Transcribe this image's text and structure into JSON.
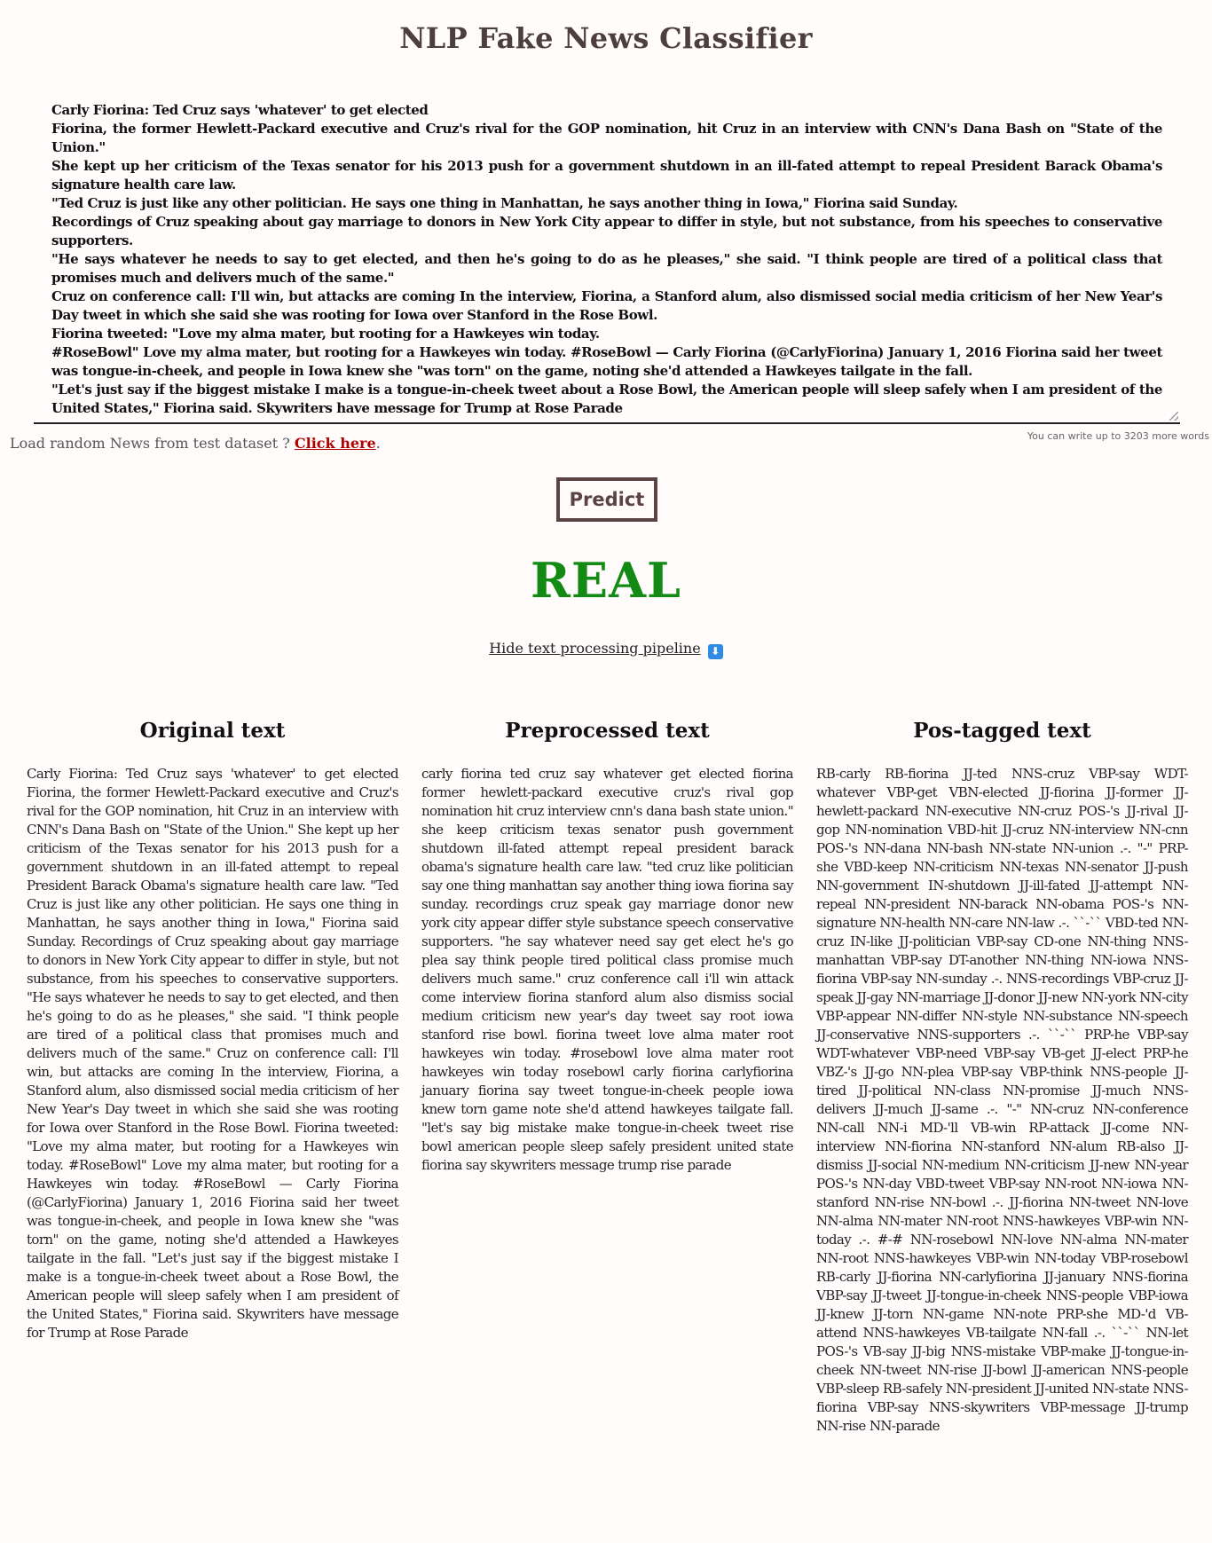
{
  "header": {
    "title": "NLP Fake News Classifier"
  },
  "input": {
    "text": "Carly Fiorina: Ted Cruz says 'whatever' to get elected\nFiorina, the former Hewlett-Packard executive and Cruz's rival for the GOP nomination, hit Cruz in an interview with CNN's Dana Bash on \"State of the Union.\"\nShe kept up her criticism of the Texas senator for his 2013 push for a government shutdown in an ill-fated attempt to repeal President Barack Obama's signature health care law.\n\"Ted Cruz is just like any other politician. He says one thing in Manhattan, he says another thing in Iowa,\" Fiorina said Sunday.\nRecordings of Cruz speaking about gay marriage to donors in New York City appear to differ in style, but not substance, from his speeches to conservative supporters.\n\"He says whatever he needs to say to get elected, and then he's going to do as he pleases,\" she said. \"I think people are tired of a political class that promises much and delivers much of the same.\"\nCruz on conference call: I'll win, but attacks are coming In the interview, Fiorina, a Stanford alum, also dismissed social media criticism of her New Year's Day tweet in which she said she was rooting for Iowa over Stanford in the Rose Bowl.\nFiorina tweeted: \"Love my alma mater, but rooting for a Hawkeyes win today.\n#RoseBowl\" Love my alma mater, but rooting for a Hawkeyes win today. #RoseBowl — Carly Fiorina (@CarlyFiorina) January 1, 2016 Fiorina said her tweet was tongue-in-cheek, and people in Iowa knew she \"was torn\" on the game, noting she'd attended a Hawkeyes tailgate in the fall.\n\"Let's just say if the biggest mistake I make is a tongue-in-cheek tweet about a Rose Bowl, the American people will sleep safely when I am president of the United States,\" Fiorina said. Skywriters have message for Trump at Rose Parade",
    "word_counter": "You can write up to 3203 more words"
  },
  "load_random": {
    "prefix": "Load random News from test dataset ? ",
    "link_label": "Click here",
    "suffix": "."
  },
  "predict_button": {
    "label": "Predict"
  },
  "result": {
    "label": "REAL",
    "color": "#138a13"
  },
  "pipeline_toggle": {
    "label": "Hide text processing pipeline",
    "icon": "down-arrow-icon",
    "icon_glyph": "⬇"
  },
  "columns": {
    "original": {
      "title": "Original text",
      "text": "Carly Fiorina: Ted Cruz says 'whatever' to get elected Fiorina, the former Hewlett-Packard executive and Cruz's rival for the GOP nomination, hit Cruz in an interview with CNN's Dana Bash on \"State of the Union.\" She kept up her criticism of the Texas senator for his 2013 push for a government shutdown in an ill-fated attempt to repeal President Barack Obama's signature health care law. \"Ted Cruz is just like any other politician. He says one thing in Manhattan, he says another thing in Iowa,\" Fiorina said Sunday. Recordings of Cruz speaking about gay marriage to donors in New York City appear to differ in style, but not substance, from his speeches to conservative supporters. \"He says whatever he needs to say to get elected, and then he's going to do as he pleases,\" she said. \"I think people are tired of a political class that promises much and delivers much of the same.\" Cruz on conference call: I'll win, but attacks are coming In the interview, Fiorina, a Stanford alum, also dismissed social media criticism of her New Year's Day tweet in which she said she was rooting for Iowa over Stanford in the Rose Bowl. Fiorina tweeted: \"Love my alma mater, but rooting for a Hawkeyes win today. #RoseBowl\" Love my alma mater, but rooting for a Hawkeyes win today. #RoseBowl — Carly Fiorina (@CarlyFiorina) January 1, 2016 Fiorina said her tweet was tongue-in-cheek, and people in Iowa knew she \"was torn\" on the game, noting she'd attended a Hawkeyes tailgate in the fall. \"Let's just say if the biggest mistake I make is a tongue-in-cheek tweet about a Rose Bowl, the American people will sleep safely when I am president of the United States,\" Fiorina said. Skywriters have message for Trump at Rose Parade"
    },
    "preprocessed": {
      "title": "Preprocessed text",
      "text": "carly fiorina ted cruz say whatever get elected fiorina former hewlett-packard executive cruz's rival gop nomination hit cruz interview cnn's dana bash state union.\" she keep criticism texas senator push government shutdown ill-fated attempt repeal president barack obama's signature health care law. \"ted cruz like politician say one thing manhattan say another thing iowa fiorina say sunday. recordings cruz speak gay marriage donor new york city appear differ style substance speech conservative supporters. \"he say whatever need say get elect he's go plea say think people tired political class promise much delivers much same.\" cruz conference call i'll win attack come interview fiorina stanford alum also dismiss social medium criticism new year's day tweet say root iowa stanford rise bowl. fiorina tweet love alma mater root hawkeyes win today. #rosebowl love alma mater root hawkeyes win today rosebowl carly fiorina carlyfiorina january fiorina say tweet tongue-in-cheek people iowa knew torn game note she'd attend hawkeyes tailgate fall. \"let's say big mistake make tongue-in-cheek tweet rise bowl american people sleep safely president united state fiorina say skywriters message trump rise parade"
    },
    "postagged": {
      "title": "Pos-tagged text",
      "text": "RB-carly RB-fiorina JJ-ted NNS-cruz VBP-say WDT-whatever VBP-get VBN-elected JJ-fiorina JJ-former JJ-hewlett-packard NN-executive NN-cruz POS-'s JJ-rival JJ-gop NN-nomination VBD-hit JJ-cruz NN-interview NN-cnn POS-'s NN-dana NN-bash NN-state NN-union .-. \"-\" PRP-she VBD-keep NN-criticism NN-texas NN-senator JJ-push NN-government IN-shutdown JJ-ill-fated JJ-attempt NN-repeal NN-president NN-barack NN-obama POS-'s NN-signature NN-health NN-care NN-law .-. ``-`` VBD-ted NN-cruz IN-like JJ-politician VBP-say CD-one NN-thing NNS-manhattan VBP-say DT-another NN-thing NN-iowa NNS-fiorina VBP-say NN-sunday .-. NNS-recordings VBP-cruz JJ-speak JJ-gay NN-marriage JJ-donor JJ-new NN-york NN-city VBP-appear NN-differ NN-style NN-substance NN-speech JJ-conservative NNS-supporters .-. ``-`` PRP-he VBP-say WDT-whatever VBP-need VBP-say VB-get JJ-elect PRP-he VBZ-'s JJ-go NN-plea VBP-say VBP-think NNS-people JJ-tired JJ-political NN-class NN-promise JJ-much NNS-delivers JJ-much JJ-same .-. \"-\" NN-cruz NN-conference NN-call NN-i MD-'ll VB-win RP-attack JJ-come NN-interview NN-fiorina NN-stanford NN-alum RB-also JJ-dismiss JJ-social NN-medium NN-criticism JJ-new NN-year POS-'s NN-day VBD-tweet VBP-say NN-root NN-iowa NN-stanford NN-rise NN-bowl .-. JJ-fiorina NN-tweet NN-love NN-alma NN-mater NN-root NNS-hawkeyes VBP-win NN-today .-. #-# NN-rosebowl NN-love NN-alma NN-mater NN-root NNS-hawkeyes VBP-win NN-today VBP-rosebowl RB-carly JJ-fiorina NN-carlyfiorina JJ-january NNS-fiorina VBP-say JJ-tweet JJ-tongue-in-cheek NNS-people VBP-iowa JJ-knew JJ-torn NN-game NN-note PRP-she MD-'d VB-attend NNS-hawkeyes VB-tailgate NN-fall .-. ``-`` NN-let POS-'s VB-say JJ-big NNS-mistake VBP-make JJ-tongue-in-cheek NN-tweet NN-rise JJ-bowl JJ-american NNS-people VBP-sleep RB-safely NN-president JJ-united NN-state NNS-fiorina VBP-say NNS-skywriters VBP-message JJ-trump NN-rise NN-parade"
    }
  }
}
